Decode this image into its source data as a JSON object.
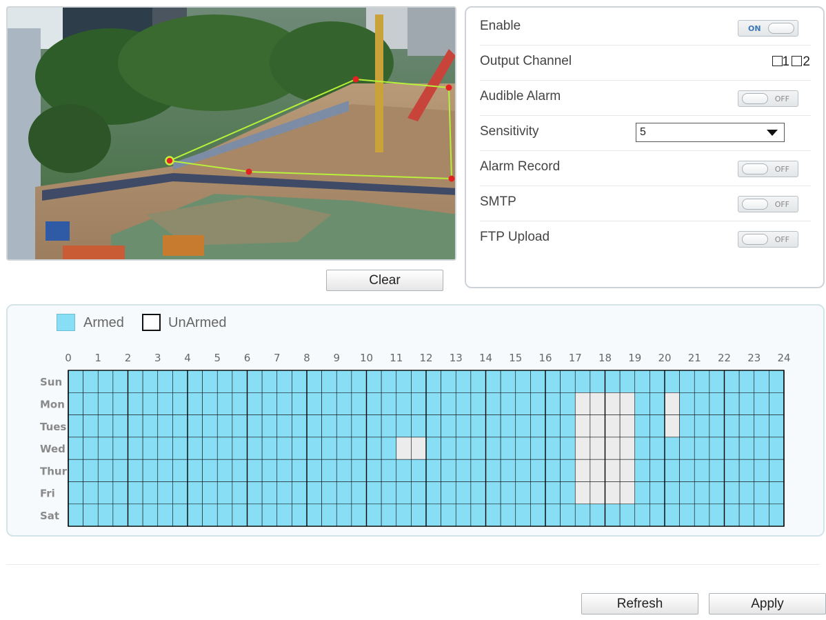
{
  "clear_label": "Clear",
  "settings": {
    "enable": {
      "label": "Enable",
      "state": "ON"
    },
    "output_channel": {
      "label": "Output Channel",
      "options": [
        "1",
        "2"
      ]
    },
    "audible_alarm": {
      "label": "Audible Alarm",
      "state": "OFF"
    },
    "sensitivity": {
      "label": "Sensitivity",
      "value": "5"
    },
    "alarm_record": {
      "label": "Alarm Record",
      "state": "OFF"
    },
    "smtp": {
      "label": "SMTP",
      "state": "OFF"
    },
    "ftp_upload": {
      "label": "FTP Upload",
      "state": "OFF"
    }
  },
  "schedule": {
    "legend": {
      "armed": "Armed",
      "unarmed": "UnArmed"
    },
    "hours": [
      "0",
      "1",
      "2",
      "3",
      "4",
      "5",
      "6",
      "7",
      "8",
      "9",
      "10",
      "11",
      "12",
      "13",
      "14",
      "15",
      "16",
      "17",
      "18",
      "19",
      "20",
      "21",
      "22",
      "23",
      "24"
    ],
    "days": [
      "Sun",
      "Mon",
      "Tues",
      "Wed",
      "Thur",
      "Fri",
      "Sat"
    ],
    "unarmed_slots": {
      "Mon": [
        [
          17,
          19
        ],
        [
          20,
          20.5
        ]
      ],
      "Tues": [
        [
          17,
          19
        ],
        [
          20,
          20.5
        ]
      ],
      "Wed": [
        [
          11,
          12
        ],
        [
          17,
          19
        ]
      ],
      "Thur": [
        [
          17,
          19
        ]
      ],
      "Fri": [
        [
          17,
          19
        ]
      ]
    },
    "colors": {
      "armed": "#88dff5",
      "unarmed": "#ececec"
    }
  },
  "footer": {
    "refresh_label": "Refresh",
    "apply_label": "Apply"
  }
}
